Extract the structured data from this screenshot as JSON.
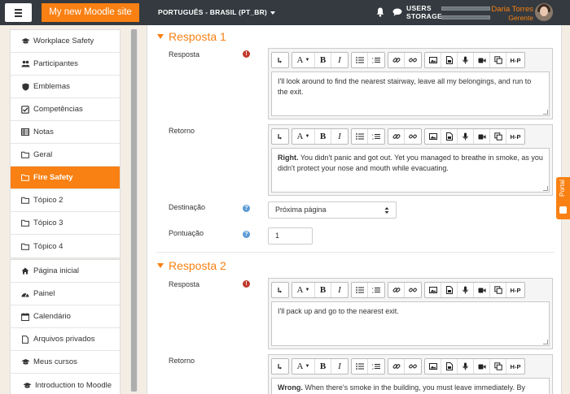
{
  "navbar": {
    "site_name": "My new Moodle site",
    "language": "PORTUGUÊS - BRASIL (PT_BR)",
    "storage_line1": "USERS",
    "storage_line2": "STORAGE",
    "user_name": "Daria Torres",
    "user_role": "Gerente"
  },
  "sidebar": {
    "course_items": [
      {
        "label": "Workplace Safety",
        "icon": "graduation-cap-icon"
      },
      {
        "label": "Participantes",
        "icon": "users-icon"
      },
      {
        "label": "Emblemas",
        "icon": "shield-icon"
      },
      {
        "label": "Competências",
        "icon": "check-square-icon"
      },
      {
        "label": "Notas",
        "icon": "table-icon"
      },
      {
        "label": "Geral",
        "icon": "folder-icon"
      },
      {
        "label": "Fire Safety",
        "icon": "folder-icon",
        "active": true
      },
      {
        "label": "Tópico 2",
        "icon": "folder-icon"
      },
      {
        "label": "Tópico 3",
        "icon": "folder-icon"
      },
      {
        "label": "Tópico 4",
        "icon": "folder-icon"
      }
    ],
    "site_items": [
      {
        "label": "Página inicial",
        "icon": "home-icon"
      },
      {
        "label": "Painel",
        "icon": "dashboard-icon"
      },
      {
        "label": "Calendário",
        "icon": "calendar-icon"
      },
      {
        "label": "Arquivos privados",
        "icon": "file-icon"
      },
      {
        "label": "Meus cursos",
        "icon": "graduation-cap-icon"
      },
      {
        "label": "Introduction to Moodle",
        "icon": "graduation-cap-icon"
      }
    ]
  },
  "form": {
    "answer1": {
      "heading": "Resposta 1",
      "answer_label": "Resposta",
      "answer_text": "I'll look around to find the nearest stairway, leave all my belongings, and run to the exit.",
      "feedback_label": "Retorno",
      "feedback_bold": "Right.",
      "feedback_text": " You didn't panic and got out. Yet you managed to breathe in smoke, as you didn't protect your nose and mouth while evacuating.",
      "jump_label": "Destinação",
      "jump_value": "Próxima página",
      "score_label": "Pontuação",
      "score_value": "1"
    },
    "answer2": {
      "heading": "Resposta 2",
      "answer_label": "Resposta",
      "answer_text": "I'll pack up and go to the nearest exit.",
      "feedback_label": "Retorno",
      "feedback_bold": "Wrong.",
      "feedback_text": " When there's smoke in the building, you must leave immediately. By"
    }
  },
  "editor_toolbar": {
    "font_label": "A",
    "bold_label": "B",
    "italic_label": "I",
    "h5p_label": "H-P"
  },
  "portal_tab": {
    "label": "Portal"
  },
  "colors": {
    "accent": "#f98012",
    "navbar": "#343a40",
    "required": "#c0392b",
    "help": "#5b9bd5"
  }
}
